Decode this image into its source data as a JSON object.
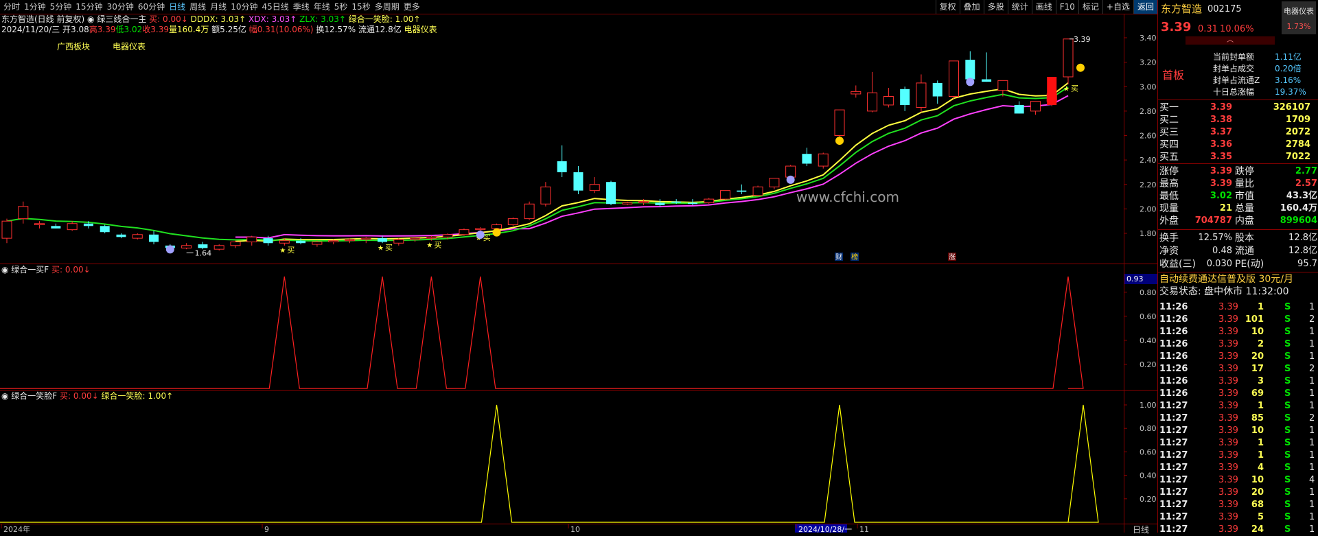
{
  "toolbar": {
    "timeframes": [
      "分时",
      "1分钟",
      "5分钟",
      "15分钟",
      "30分钟",
      "60分钟",
      "日线",
      "周线",
      "月线",
      "10分钟",
      "45日线",
      "季线",
      "年线",
      "5秒",
      "15秒",
      "多周期",
      "更多"
    ],
    "active_timeframe": "日线",
    "right_buttons": [
      "复权",
      "叠加",
      "多股",
      "统计",
      "画线",
      "F10",
      "标记",
      "+自选",
      "返回"
    ],
    "active_right": "返回"
  },
  "header": {
    "stock": "东方智造(日线 前复权)",
    "indicator_name": "绿三线合一主",
    "buy_label": "买: 0.00↓",
    "dddx": "DDDX: 3.03↑",
    "xdx": "XDX: 3.03↑",
    "zlx": "ZLX: 3.03↑",
    "combo": "绿合一笑脸: 1.00↑",
    "date": "2024/11/20/三",
    "open": "开3.08",
    "high": "高3.39",
    "low": "低3.02",
    "close": "收3.39",
    "volume": "量160.4万",
    "amount": "额5.25亿",
    "change": "幅0.31(10.06%)",
    "turnover": "换12.57%",
    "float": "流通12.8亿",
    "sector": "电器仪表",
    "tag1": "广西板块",
    "tag2": "电器仪表"
  },
  "chart_main": {
    "watermark": "www.cfchi.com",
    "y_ticks": [
      "3.40",
      "3.20",
      "3.00",
      "2.80",
      "2.60",
      "2.40",
      "2.20",
      "2.00",
      "1.80"
    ],
    "high_label": "3.39",
    "low_label": "1.64",
    "buy_marks": [
      "买",
      "买",
      "买",
      "买",
      "买"
    ],
    "event_marks": [
      "财",
      "榜",
      "涨"
    ]
  },
  "chart_data": [
    {
      "type": "candlestick",
      "title": "东方智造(日线 前复权)",
      "ylim": [
        1.6,
        3.45
      ],
      "candles": [
        [
          1.76,
          1.92,
          1.72,
          1.9
        ],
        [
          1.92,
          2.06,
          1.88,
          2.02
        ],
        [
          1.87,
          1.9,
          1.84,
          1.88
        ],
        [
          1.86,
          1.88,
          1.84,
          1.84
        ],
        [
          1.83,
          1.9,
          1.82,
          1.88
        ],
        [
          1.88,
          1.9,
          1.84,
          1.86
        ],
        [
          1.86,
          1.87,
          1.8,
          1.81
        ],
        [
          1.79,
          1.8,
          1.76,
          1.77
        ],
        [
          1.76,
          1.8,
          1.75,
          1.79
        ],
        [
          1.79,
          1.82,
          1.71,
          1.73
        ],
        [
          1.7,
          1.71,
          1.68,
          1.68
        ],
        [
          1.68,
          1.72,
          1.67,
          1.7
        ],
        [
          1.71,
          1.73,
          1.67,
          1.68
        ],
        [
          1.67,
          1.71,
          1.66,
          1.7
        ],
        [
          1.7,
          1.74,
          1.68,
          1.73
        ],
        [
          1.73,
          1.78,
          1.7,
          1.77
        ],
        [
          1.76,
          1.78,
          1.7,
          1.72
        ],
        [
          1.72,
          1.76,
          1.7,
          1.74
        ],
        [
          1.74,
          1.76,
          1.71,
          1.72
        ],
        [
          1.71,
          1.74,
          1.69,
          1.73
        ],
        [
          1.73,
          1.75,
          1.71,
          1.74
        ],
        [
          1.74,
          1.76,
          1.72,
          1.75
        ],
        [
          1.75,
          1.77,
          1.72,
          1.76
        ],
        [
          1.76,
          1.78,
          1.72,
          1.73
        ],
        [
          1.72,
          1.76,
          1.7,
          1.75
        ],
        [
          1.75,
          1.77,
          1.73,
          1.76
        ],
        [
          1.76,
          1.78,
          1.74,
          1.77
        ],
        [
          1.77,
          1.8,
          1.75,
          1.79
        ],
        [
          1.79,
          1.84,
          1.78,
          1.83
        ],
        [
          1.83,
          1.85,
          1.8,
          1.84
        ],
        [
          1.84,
          1.88,
          1.83,
          1.87
        ],
        [
          1.87,
          1.93,
          1.86,
          1.92
        ],
        [
          1.92,
          2.06,
          1.91,
          2.04
        ],
        [
          2.04,
          2.22,
          2.02,
          2.18
        ],
        [
          2.39,
          2.52,
          2.26,
          2.3
        ],
        [
          2.3,
          2.35,
          2.12,
          2.15
        ],
        [
          2.15,
          2.26,
          2.13,
          2.2
        ],
        [
          2.22,
          2.23,
          2.03,
          2.04
        ],
        [
          2.04,
          2.06,
          2.03,
          2.05
        ],
        [
          2.05,
          2.08,
          2.03,
          2.06
        ],
        [
          2.05,
          2.08,
          2.02,
          2.03
        ],
        [
          2.06,
          2.08,
          2.04,
          2.05
        ],
        [
          2.05,
          2.08,
          2.03,
          2.04
        ],
        [
          2.05,
          2.09,
          2.04,
          2.08
        ],
        [
          2.08,
          2.12,
          2.07,
          2.15
        ],
        [
          2.15,
          2.2,
          2.12,
          2.14
        ],
        [
          2.11,
          2.19,
          2.1,
          2.18
        ],
        [
          2.18,
          2.25,
          2.16,
          2.25
        ],
        [
          2.26,
          2.36,
          2.25,
          2.35
        ],
        [
          2.45,
          2.5,
          2.35,
          2.37
        ],
        [
          2.35,
          2.46,
          2.33,
          2.45
        ],
        [
          2.6,
          2.74,
          2.58,
          2.81
        ],
        [
          2.94,
          3.01,
          2.91,
          2.96
        ],
        [
          2.8,
          3.12,
          2.79,
          2.95
        ],
        [
          2.85,
          2.99,
          2.83,
          2.92
        ],
        [
          2.98,
          3.0,
          2.8,
          2.85
        ],
        [
          2.83,
          3.1,
          2.79,
          3.03
        ],
        [
          3.03,
          3.05,
          2.86,
          2.92
        ],
        [
          2.92,
          3.2,
          2.9,
          3.21
        ],
        [
          3.22,
          3.29,
          3.05,
          3.06
        ],
        [
          3.06,
          3.28,
          3.04,
          3.04
        ],
        [
          2.97,
          3.05,
          2.92,
          3.05
        ],
        [
          2.85,
          2.88,
          2.78,
          2.78
        ],
        [
          2.8,
          2.86,
          2.77,
          2.88
        ],
        [
          2.88,
          2.99,
          2.84,
          2.94
        ],
        [
          3.08,
          3.39,
          3.02,
          3.39
        ]
      ],
      "ma_lines": [
        "DDDX",
        "XDX",
        "ZLX"
      ]
    },
    {
      "type": "line",
      "title": "绿合一买F",
      "ylim": [
        0,
        0.93
      ],
      "y_ticks": [
        "0.93",
        "0.80",
        "0.60",
        "0.40",
        "0.20"
      ],
      "peaks_at_candle": [
        17,
        23,
        26,
        29,
        65
      ],
      "values_peak": 1.0,
      "color": "#ff2020"
    },
    {
      "type": "line",
      "title": "绿合一笑脸F",
      "ylim": [
        0,
        1.0
      ],
      "y_ticks": [
        "1.00",
        "0.80",
        "0.60",
        "0.40",
        "0.20"
      ],
      "peaks_at_candle": [
        30,
        51,
        66
      ],
      "values_peak": 1.0,
      "color": "#ffff00"
    }
  ],
  "sub1": {
    "title": "绿合一买F",
    "buy": "买: 0.00↓",
    "current_value": "0.93"
  },
  "sub2": {
    "title": "绿合一笑脸F",
    "buy": "买: 0.00↓",
    "combo": "绿合一笑脸: 1.00↑"
  },
  "x_axis": {
    "labels": [
      "2024年",
      "9",
      "10",
      "2024/10/28/一",
      "11"
    ],
    "right_label": "日线"
  },
  "panel": {
    "name": "东方智造",
    "code": "002175",
    "sector": "电器仪表",
    "sector_pct": "1.73%",
    "price": "3.39",
    "change": "0.31",
    "pct": "10.06%",
    "status": "首板",
    "seal_stats": [
      {
        "label": "当前封单额",
        "value": "1.11亿"
      },
      {
        "label": "封单占成交",
        "value": "0.20倍"
      },
      {
        "label": "封单占流通Z",
        "value": "3.16%"
      },
      {
        "label": "十日总涨幅",
        "value": "19.37%"
      }
    ],
    "bids": [
      {
        "label": "买一",
        "price": "3.39",
        "vol": "326107"
      },
      {
        "label": "买二",
        "price": "3.38",
        "vol": "1709"
      },
      {
        "label": "买三",
        "price": "3.37",
        "vol": "2072"
      },
      {
        "label": "买四",
        "price": "3.36",
        "vol": "2784"
      },
      {
        "label": "买五",
        "price": "3.35",
        "vol": "7022"
      }
    ],
    "stats": [
      {
        "l1": "涨停",
        "v1": "3.39",
        "l2": "跌停",
        "v2": "2.77"
      },
      {
        "l1": "最高",
        "v1": "3.39",
        "l2": "量比",
        "v2": "2.57"
      },
      {
        "l1": "最低",
        "v1": "3.02",
        "l2": "市值",
        "v2": "43.3亿"
      },
      {
        "l1": "现量",
        "v1": "21",
        "l2": "总量",
        "v2": "160.4万"
      },
      {
        "l1": "外盘",
        "v1": "704787",
        "l2": "内盘",
        "v2": "899604"
      }
    ],
    "stats2": [
      {
        "l1": "换手",
        "v1": "12.57%",
        "l2": "股本",
        "v2": "12.8亿"
      },
      {
        "l1": "净资",
        "v1": "0.48",
        "l2": "流通",
        "v2": "12.8亿"
      },
      {
        "l1": "收益(三)",
        "v1": "0.030",
        "l2": "PE(动)",
        "v2": "95.7"
      }
    ],
    "ad": "自动续费通达信普及版 30元/月",
    "trade_status": "交易状态: 盘中休市 11:32:00",
    "ticks": [
      {
        "t": "11:26",
        "p": "3.39",
        "v": "1",
        "s": "S",
        "n": "1"
      },
      {
        "t": "11:26",
        "p": "3.39",
        "v": "101",
        "s": "S",
        "n": "2"
      },
      {
        "t": "11:26",
        "p": "3.39",
        "v": "10",
        "s": "S",
        "n": "1"
      },
      {
        "t": "11:26",
        "p": "3.39",
        "v": "2",
        "s": "S",
        "n": "1"
      },
      {
        "t": "11:26",
        "p": "3.39",
        "v": "20",
        "s": "S",
        "n": "1"
      },
      {
        "t": "11:26",
        "p": "3.39",
        "v": "17",
        "s": "S",
        "n": "2"
      },
      {
        "t": "11:26",
        "p": "3.39",
        "v": "3",
        "s": "S",
        "n": "1"
      },
      {
        "t": "11:26",
        "p": "3.39",
        "v": "69",
        "s": "S",
        "n": "1"
      },
      {
        "t": "11:27",
        "p": "3.39",
        "v": "1",
        "s": "S",
        "n": "1"
      },
      {
        "t": "11:27",
        "p": "3.39",
        "v": "85",
        "s": "S",
        "n": "2"
      },
      {
        "t": "11:27",
        "p": "3.39",
        "v": "10",
        "s": "S",
        "n": "1"
      },
      {
        "t": "11:27",
        "p": "3.39",
        "v": "1",
        "s": "S",
        "n": "1"
      },
      {
        "t": "11:27",
        "p": "3.39",
        "v": "1",
        "s": "S",
        "n": "1"
      },
      {
        "t": "11:27",
        "p": "3.39",
        "v": "4",
        "s": "S",
        "n": "1"
      },
      {
        "t": "11:27",
        "p": "3.39",
        "v": "10",
        "s": "S",
        "n": "4"
      },
      {
        "t": "11:27",
        "p": "3.39",
        "v": "20",
        "s": "S",
        "n": "1"
      },
      {
        "t": "11:27",
        "p": "3.39",
        "v": "68",
        "s": "S",
        "n": "1"
      },
      {
        "t": "11:27",
        "p": "3.39",
        "v": "5",
        "s": "S",
        "n": "1"
      },
      {
        "t": "11:27",
        "p": "3.39",
        "v": "24",
        "s": "S",
        "n": "1"
      }
    ]
  }
}
